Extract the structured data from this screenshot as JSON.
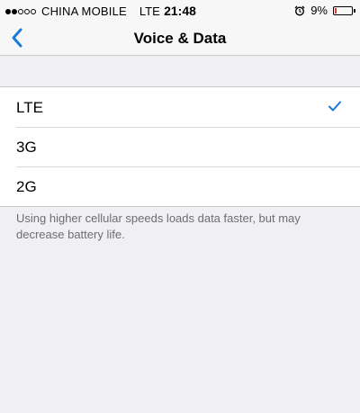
{
  "status_bar": {
    "carrier": "CHINA MOBILE",
    "network": "LTE",
    "time": "21:48",
    "battery": "9%",
    "signal_bars_filled": 2,
    "signal_bars_total": 5,
    "battery_level": 0.09,
    "alarm_icon": "alarm-clock-icon"
  },
  "nav": {
    "title": "Voice & Data",
    "back_icon": "chevron-left-icon"
  },
  "options": [
    {
      "label": "LTE",
      "selected": true
    },
    {
      "label": "3G",
      "selected": false
    },
    {
      "label": "2G",
      "selected": false
    }
  ],
  "footer": {
    "text": "Using higher cellular speeds loads data faster, but may decrease battery life."
  },
  "colors": {
    "accent": "#1a7bd6",
    "background": "#efeff4",
    "battery_low": "#e23a2c",
    "footer_text": "#6d6d72"
  }
}
